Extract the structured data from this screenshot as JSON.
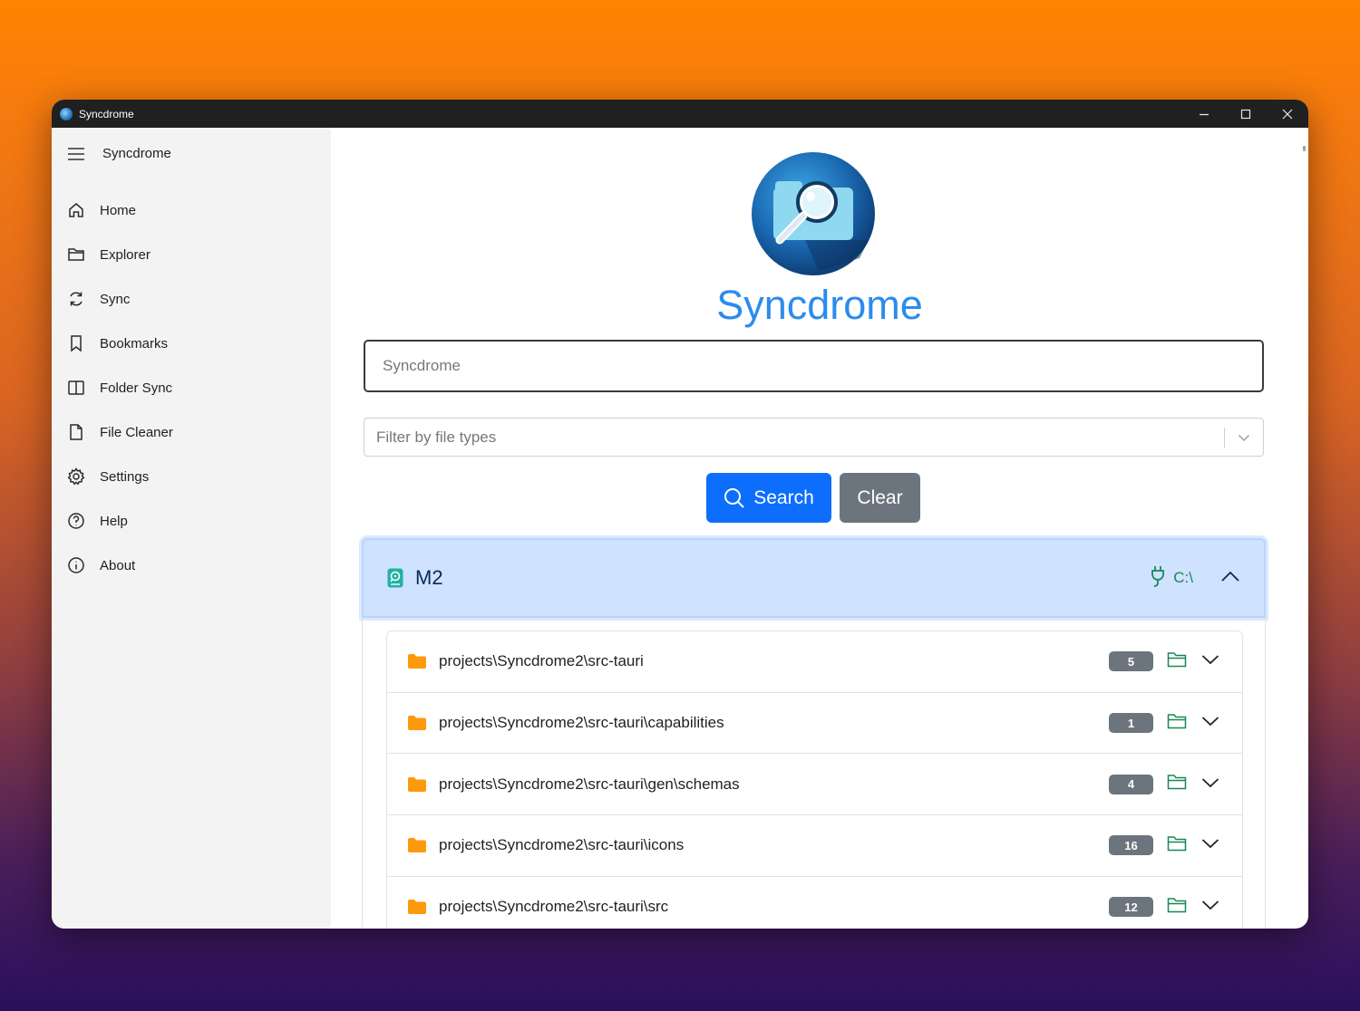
{
  "window": {
    "title": "Syncdrome"
  },
  "sidebar": {
    "header": "Syncdrome",
    "items": [
      {
        "label": "Home",
        "icon": "home-icon"
      },
      {
        "label": "Explorer",
        "icon": "folder-icon"
      },
      {
        "label": "Sync",
        "icon": "sync-icon"
      },
      {
        "label": "Bookmarks",
        "icon": "bookmark-icon"
      },
      {
        "label": "Folder Sync",
        "icon": "columns-icon"
      },
      {
        "label": "File Cleaner",
        "icon": "file-icon"
      },
      {
        "label": "Settings",
        "icon": "gear-icon"
      },
      {
        "label": "Help",
        "icon": "question-icon"
      },
      {
        "label": "About",
        "icon": "info-icon"
      }
    ]
  },
  "main": {
    "app_title": "Syncdrome",
    "search": {
      "placeholder": "Syncdrome",
      "value": ""
    },
    "filter": {
      "placeholder": "Filter by file types"
    },
    "search_button": "Search",
    "clear_button": "Clear"
  },
  "drive": {
    "name": "M2",
    "mount": "C:\\",
    "connected": true,
    "folders": [
      {
        "path": "projects\\Syncdrome2\\src-tauri",
        "count": "5"
      },
      {
        "path": "projects\\Syncdrome2\\src-tauri\\capabilities",
        "count": "1"
      },
      {
        "path": "projects\\Syncdrome2\\src-tauri\\gen\\schemas",
        "count": "4"
      },
      {
        "path": "projects\\Syncdrome2\\src-tauri\\icons",
        "count": "16"
      },
      {
        "path": "projects\\Syncdrome2\\src-tauri\\src",
        "count": "12"
      }
    ]
  },
  "colors": {
    "accent": "#2b8cec",
    "primary_button": "#0d6efd",
    "secondary_button": "#6c757d",
    "success": "#198754",
    "folder": "#fd9a0c",
    "accordion_header": "#cfe2ff"
  }
}
